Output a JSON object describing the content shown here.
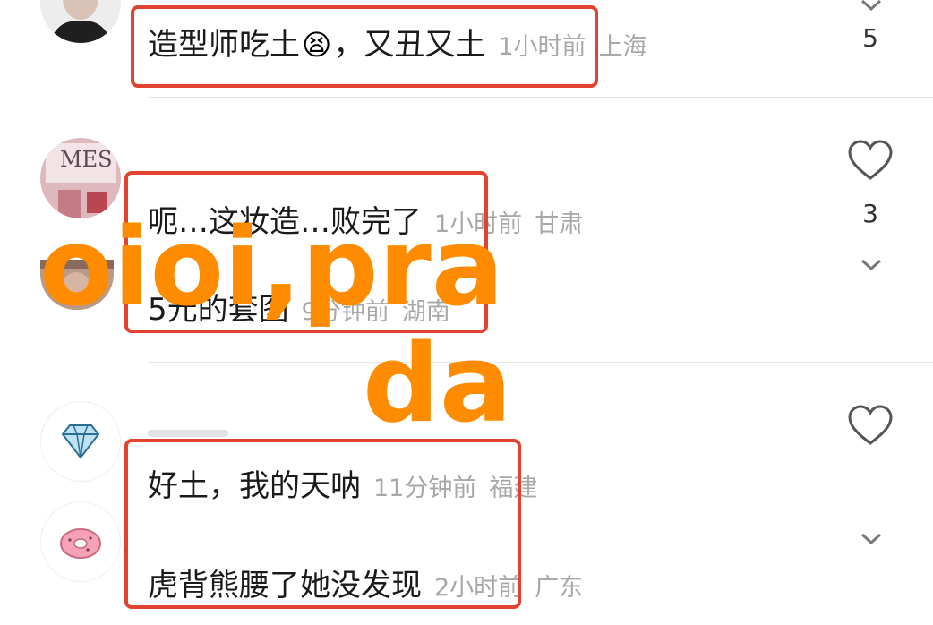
{
  "watermark": {
    "line1": "oioi,pra",
    "line2": "da"
  },
  "comments": [
    {
      "text": "造型师吃土",
      "emoji": "😫",
      "text_after": "，又丑又土",
      "time": "1小时前",
      "location": "上海",
      "likes": "5"
    },
    {
      "text": "呃…这妆造…败完了",
      "time": "1小时前",
      "location": "甘肃",
      "likes": "3"
    },
    {
      "text": "5元的套图",
      "time": "9分钟前",
      "location": "湖南"
    },
    {
      "text": "好土，我的天呐",
      "time": "11分钟前",
      "location": "福建"
    },
    {
      "text": "虎背熊腰了她没发现",
      "time": "2小时前",
      "location": "广东"
    }
  ],
  "avatar_texts": {
    "me_sign": "MES"
  },
  "icons": [
    "heart-icon",
    "chevron-down-icon",
    "diamond-icon",
    "donut-icon"
  ],
  "colors": {
    "highlight": "#e2432f",
    "watermark": "#ff8c00",
    "meta_text": "#a8a8a8"
  }
}
